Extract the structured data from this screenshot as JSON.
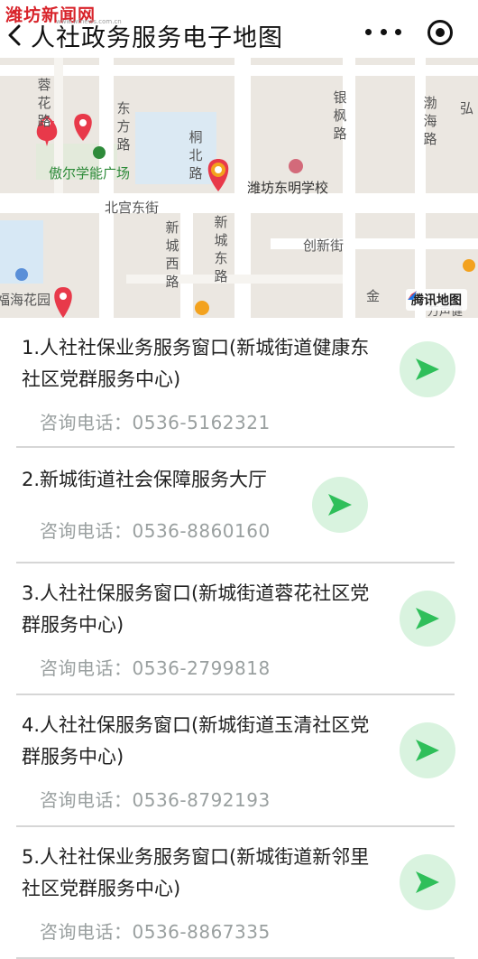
{
  "header": {
    "watermark": "潍坊新闻网",
    "watermark_sub": "www.wfnews.com.cn",
    "title": "人社政务服务电子地图"
  },
  "map": {
    "roads": [
      "东方路",
      "桐北路",
      "银枫路",
      "渤海路",
      "蓉花路",
      "北宫东街",
      "新城西路",
      "新城东路",
      "创新街",
      "弘"
    ],
    "pois": {
      "square": "傲尔学能广场",
      "school": "潍坊东明学校",
      "garden": "福海花园"
    },
    "provider": "腾讯地图",
    "edge_fragments": [
      "金",
      "万声健"
    ]
  },
  "locations": [
    {
      "name": "1.人社社保业务服务窗口(新城街道健康东社区党群服务中心)",
      "phone": "咨询电话：0536-5162321"
    },
    {
      "name": "2.新城街道社会保障服务大厅",
      "phone": "咨询电话：0536-8860160"
    },
    {
      "name": "3.人社社保服务窗口(新城街道蓉花社区党群服务中心)",
      "phone": "咨询电话：0536-2799818"
    },
    {
      "name": "4.人社社保服务窗口(新城街道玉清社区党群服务中心)",
      "phone": "咨询电话：0536-8792193"
    },
    {
      "name": "5.人社社保业务服务窗口(新城街道新邻里社区党群服务中心)",
      "phone": "咨询电话：0536-8867335"
    }
  ],
  "colors": {
    "accent_green": "#2fbf5a",
    "nav_bg": "#d9f3df",
    "pin_red": "#e8394a",
    "watermark_red": "#d8232a"
  }
}
